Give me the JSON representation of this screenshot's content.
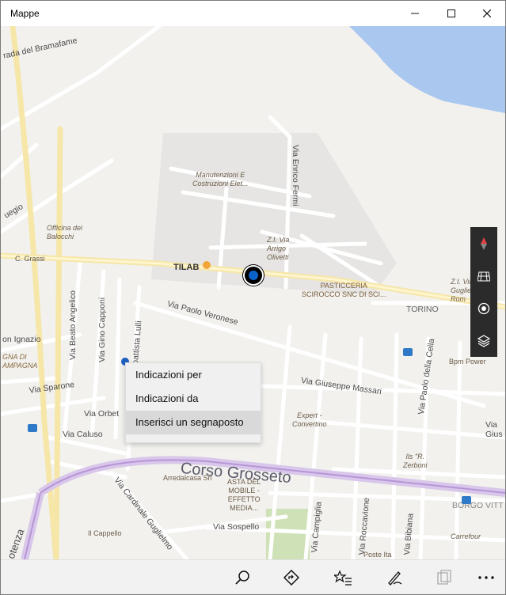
{
  "window": {
    "title": "Mappe"
  },
  "map": {
    "streets": {
      "bramafame": "rada del Bramafame",
      "enrico_fermi": "Via Enrico Fermi",
      "paolo_veronese": "Via Paolo Veronese",
      "beato_angelico": "Via Beato Angelico",
      "gino_capponi": "Via Gino Capponi",
      "lulli": "Via Giambattista Lulli",
      "sparone": "Via Sparone",
      "orbe": "Via Orbet",
      "caluso": "Via Caluso",
      "corso_grosseto": "Corso Grosseto",
      "cardinale": "Via Cardinale Guglielmo",
      "sospello": "Via Sospello",
      "giuseppe_massari": "Via Giuseppe Massari",
      "paolo_della_cella": "Via Paolo della Cella",
      "campiglia": "Via Campiglia",
      "roccavione": "Via Roccavione",
      "bibiana": "Via Bibiana",
      "torino": "TORINO",
      "borgo_vitt": "BORGO VITT",
      "zi_right": "Z.I. Via\nGuglielm\nRom",
      "ignazio": "on Ignazio",
      "uegio": "uegio",
      "agna": "GNA DI\nAMPAGNA",
      "via_gius_right": "Via\nGius",
      "otenz": "otenza"
    },
    "businesses": {
      "manutenzioni": "Manutenzioni E\nCostruzioni Elet...",
      "officina": "Officina dei\nBalocchi",
      "c_grassi": "C. Grassi",
      "tilab": "TILAB",
      "zi_arrigo": "Z.I. Via\nArrigo\nOlivetti",
      "pasticceria": "PASTICCERIA\nSCIROCCO SNC DI SCI...",
      "expert": "Expert -\nConvertino",
      "arredalcasa": "Arredalcasa Srl",
      "asta": "ASTA DEL\nMOBILE -\nEFFETTO\nMEDIA...",
      "ils_zerboni": "Ils \"R.\nZerboni",
      "bpm": "Bpm Power",
      "carrefour": "Carrefour",
      "il_cappello": "Il Cappello",
      "poste": "Poste Ita"
    }
  },
  "context_menu": {
    "items": [
      "Indicazioni per",
      "Indicazioni da",
      "Inserisci un segnaposto"
    ],
    "hovered_index": 2
  }
}
